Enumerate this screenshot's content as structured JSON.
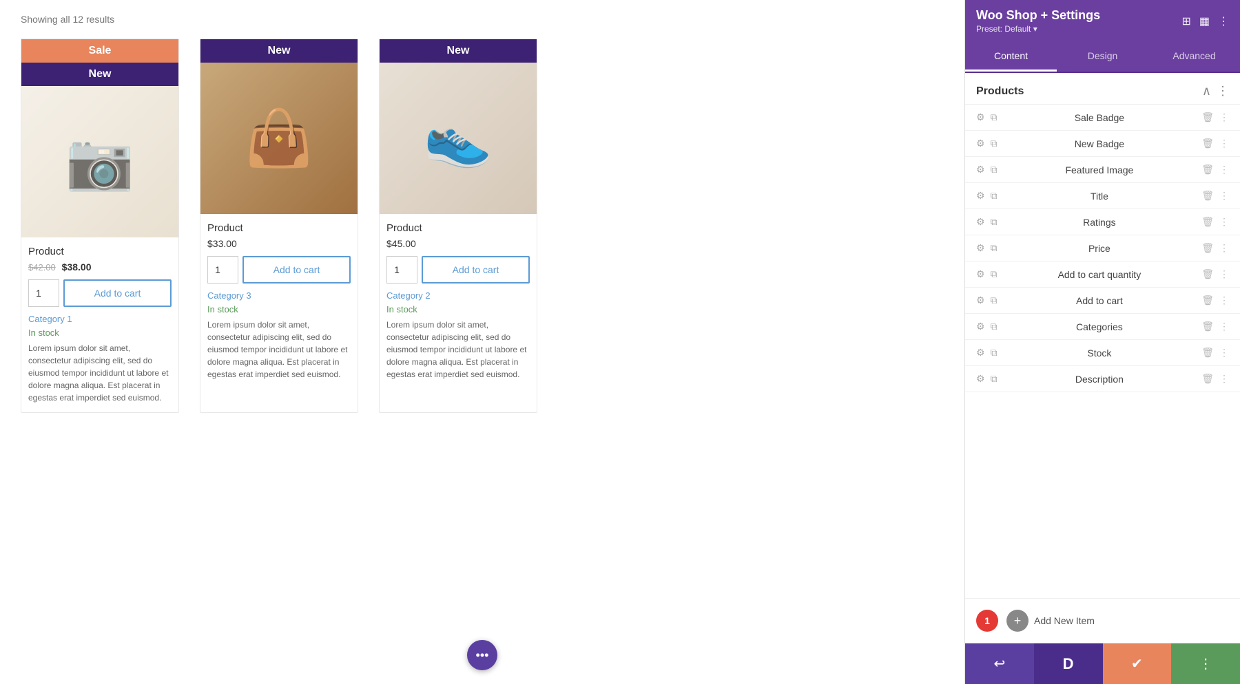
{
  "main": {
    "showing_results": "Showing all 12 results",
    "products": [
      {
        "id": "product-1",
        "badges": [
          "Sale",
          "New"
        ],
        "image_type": "camera-bag",
        "name": "Product",
        "price_old": "$42.00",
        "price_new": "$38.00",
        "qty": 1,
        "add_to_cart": "Add to cart",
        "category": "Category 1",
        "stock": "In stock",
        "description": "Lorem ipsum dolor sit amet, consectetur adipiscing elit, sed do eiusmod tempor incididunt ut labore et dolore magna aliqua. Est placerat in egestas erat imperdiet sed euismod."
      },
      {
        "id": "product-2",
        "badges": [
          "New"
        ],
        "image_type": "bag",
        "name": "Product",
        "price": "$33.00",
        "qty": 1,
        "add_to_cart": "Add to cart",
        "category": "Category 3",
        "stock": "In stock",
        "description": "Lorem ipsum dolor sit amet, consectetur adipiscing elit, sed do eiusmod tempor incididunt ut labore et dolore magna aliqua. Est placerat in egestas erat imperdiet sed euismod."
      },
      {
        "id": "product-3",
        "badges": [
          "New"
        ],
        "image_type": "shoes",
        "name": "Product",
        "price": "$45.00",
        "qty": 1,
        "add_to_cart": "Add to cart",
        "category": "Category 2",
        "stock": "In stock",
        "description": "Lorem ipsum dolor sit amet, consectetur adipiscing elit, sed do eiusmod tempor incididunt ut labore et dolore magna aliqua. Est placerat in egestas erat imperdiet sed euismod."
      }
    ],
    "float_btn": "•••"
  },
  "panel": {
    "title": "Woo Shop + Settings",
    "subtitle": "Preset: Default",
    "tabs": [
      {
        "id": "content",
        "label": "Content",
        "active": true
      },
      {
        "id": "design",
        "label": "Design",
        "active": false
      },
      {
        "id": "advanced",
        "label": "Advanced",
        "active": false
      }
    ],
    "section": {
      "title": "Products",
      "items": [
        {
          "id": "sale-badge",
          "label": "Sale Badge"
        },
        {
          "id": "new-badge",
          "label": "New Badge"
        },
        {
          "id": "featured-image",
          "label": "Featured Image"
        },
        {
          "id": "title",
          "label": "Title"
        },
        {
          "id": "ratings",
          "label": "Ratings"
        },
        {
          "id": "price",
          "label": "Price"
        },
        {
          "id": "add-to-cart-quantity",
          "label": "Add to cart quantity"
        },
        {
          "id": "add-to-cart",
          "label": "Add to cart"
        },
        {
          "id": "categories",
          "label": "Categories"
        },
        {
          "id": "stock",
          "label": "Stock"
        },
        {
          "id": "description",
          "label": "Description"
        }
      ]
    },
    "footer": {
      "count": "1",
      "add_new_label": "Add New Item"
    },
    "bottom_bar": [
      {
        "id": "btn-1",
        "icon": "↩",
        "type": "purple"
      },
      {
        "id": "btn-2",
        "icon": "D",
        "type": "dark-purple"
      },
      {
        "id": "btn-3",
        "icon": "✔",
        "type": "orange"
      },
      {
        "id": "btn-4",
        "icon": "⋮",
        "type": "green"
      }
    ]
  }
}
